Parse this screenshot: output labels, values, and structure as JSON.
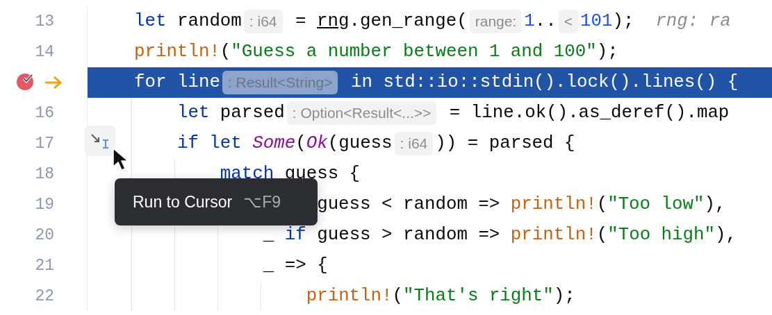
{
  "lines": [
    {
      "number": "13",
      "breakpoint": false,
      "execution_point": false,
      "current": false,
      "run_to_cursor_button": false,
      "tokens": [
        {
          "kind": "keyword",
          "text": "let"
        },
        {
          "kind": "plain",
          "text": " random"
        },
        {
          "kind": "hint",
          "text": ": i64"
        },
        {
          "kind": "plain",
          "text": " = "
        },
        {
          "kind": "underlined",
          "text": "rng"
        },
        {
          "kind": "plain",
          "text": ".gen_range("
        },
        {
          "kind": "hint",
          "text": "range:"
        },
        {
          "kind": "number",
          "text": "1"
        },
        {
          "kind": "plain",
          "text": ".."
        },
        {
          "kind": "hint",
          "text": "<"
        },
        {
          "kind": "number",
          "text": "101"
        },
        {
          "kind": "plain",
          "text": ");"
        },
        {
          "kind": "inline_value",
          "text": "  rng: ra"
        }
      ]
    },
    {
      "number": "14",
      "breakpoint": false,
      "execution_point": false,
      "current": false,
      "run_to_cursor_button": false,
      "tokens": [
        {
          "kind": "macro",
          "text": "println!"
        },
        {
          "kind": "plain",
          "text": "("
        },
        {
          "kind": "string",
          "text": "\"Guess a number between 1 and 100\""
        },
        {
          "kind": "plain",
          "text": ");"
        }
      ]
    },
    {
      "breakpoint": true,
      "execution_point": true,
      "current": true,
      "run_to_cursor_button": false,
      "tokens": [
        {
          "kind": "keyword",
          "text": "for"
        },
        {
          "kind": "plain",
          "text": " line"
        },
        {
          "kind": "hint",
          "text": ": Result<String>"
        },
        {
          "kind": "keyword",
          "text": " in"
        },
        {
          "kind": "plain",
          "text": " std::io::stdin().lock().lines() {"
        }
      ]
    },
    {
      "number": "16",
      "breakpoint": false,
      "execution_point": false,
      "current": false,
      "run_to_cursor_button": false,
      "tokens": [
        {
          "kind": "keyword",
          "text": "    let"
        },
        {
          "kind": "plain",
          "text": " parsed"
        },
        {
          "kind": "hint",
          "text": ": Option<Result<...>>"
        },
        {
          "kind": "plain",
          "text": " = line.ok().as_deref().map"
        }
      ]
    },
    {
      "number": "17",
      "breakpoint": false,
      "execution_point": false,
      "current": false,
      "run_to_cursor_button": true,
      "tokens": [
        {
          "kind": "keyword",
          "text": "    if let "
        },
        {
          "kind": "variant",
          "text": "Some"
        },
        {
          "kind": "plain",
          "text": "("
        },
        {
          "kind": "variant",
          "text": "Ok"
        },
        {
          "kind": "plain",
          "text": "(guess"
        },
        {
          "kind": "hint",
          "text": ": i64"
        },
        {
          "kind": "plain",
          "text": ")) = parsed {"
        }
      ]
    },
    {
      "number": "18",
      "breakpoint": false,
      "execution_point": false,
      "current": false,
      "run_to_cursor_button": false,
      "tokens": [
        {
          "kind": "keyword",
          "text": "        match"
        },
        {
          "kind": "plain",
          "text": " guess {"
        }
      ]
    },
    {
      "number": "19",
      "breakpoint": false,
      "execution_point": false,
      "current": false,
      "run_to_cursor_button": false,
      "tokens": [
        {
          "kind": "plain",
          "text": "                 guess < random => "
        },
        {
          "kind": "macro",
          "text": "println!"
        },
        {
          "kind": "plain",
          "text": "("
        },
        {
          "kind": "string",
          "text": "\"Too low\""
        },
        {
          "kind": "plain",
          "text": "),"
        }
      ]
    },
    {
      "number": "20",
      "breakpoint": false,
      "execution_point": false,
      "current": false,
      "run_to_cursor_button": false,
      "tokens": [
        {
          "kind": "plain",
          "text": "            _ "
        },
        {
          "kind": "keyword",
          "text": "if"
        },
        {
          "kind": "plain",
          "text": " guess > random => "
        },
        {
          "kind": "macro",
          "text": "println!"
        },
        {
          "kind": "plain",
          "text": "("
        },
        {
          "kind": "string",
          "text": "\"Too high\""
        },
        {
          "kind": "plain",
          "text": "),"
        }
      ]
    },
    {
      "number": "21",
      "breakpoint": false,
      "execution_point": false,
      "current": false,
      "run_to_cursor_button": false,
      "tokens": [
        {
          "kind": "plain",
          "text": "            _ => {"
        }
      ]
    },
    {
      "number": "22",
      "breakpoint": false,
      "execution_point": false,
      "current": false,
      "run_to_cursor_button": false,
      "tokens": [
        {
          "kind": "macro",
          "text": "                println!"
        },
        {
          "kind": "plain",
          "text": "("
        },
        {
          "kind": "string",
          "text": "\"That's right\""
        },
        {
          "kind": "plain",
          "text": ");"
        }
      ]
    }
  ],
  "tooltip": {
    "label": "Run to Cursor",
    "shortcut": "⌥F9"
  }
}
